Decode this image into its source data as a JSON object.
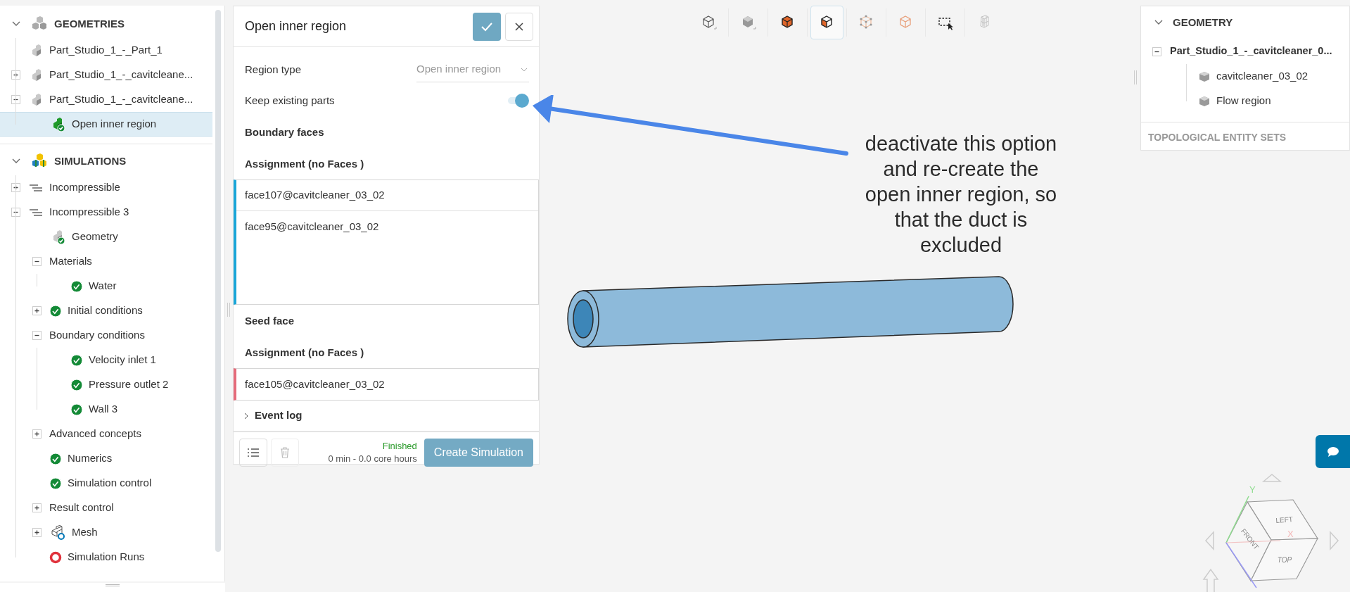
{
  "sidebar": {
    "sections": [
      {
        "title": "GEOMETRIES",
        "kind": "geometries",
        "expanded": true,
        "items": [
          {
            "label": "Part_Studio_1_-_Part_1",
            "kind": "part",
            "selected": false
          },
          {
            "label": "Part_Studio_1_-_cavitcleane...",
            "kind": "part",
            "expanded": false,
            "selected": false
          },
          {
            "label": "Part_Studio_1_-_cavitcleane...",
            "kind": "part",
            "expanded": true,
            "selected": false,
            "children": [
              {
                "label": "Open inner region",
                "kind": "region-check",
                "selected": true
              }
            ]
          }
        ]
      },
      {
        "title": "SIMULATIONS",
        "kind": "simulations",
        "expanded": true,
        "items": [
          {
            "label": "Incompressible",
            "kind": "lines",
            "expanded": false,
            "selected": false
          },
          {
            "label": "Incompressible 3",
            "kind": "lines",
            "expanded": true,
            "selected": false,
            "children": [
              {
                "label": "Geometry",
                "kind": "geometry-check",
                "selected": false
              },
              {
                "label": "Materials",
                "kind": "plain",
                "expanded": true,
                "selected": false,
                "children": [
                  {
                    "label": "Water",
                    "kind": "check",
                    "selected": false
                  }
                ]
              },
              {
                "label": "Initial conditions",
                "kind": "check",
                "expanded": false,
                "selected": false
              },
              {
                "label": "Boundary conditions",
                "kind": "plain",
                "expanded": true,
                "selected": false,
                "children": [
                  {
                    "label": "Velocity inlet 1",
                    "kind": "check",
                    "selected": false
                  },
                  {
                    "label": "Pressure outlet 2",
                    "kind": "check",
                    "selected": false
                  },
                  {
                    "label": "Wall 3",
                    "kind": "check",
                    "selected": false
                  }
                ]
              },
              {
                "label": "Advanced concepts",
                "kind": "plain",
                "expanded": false,
                "selected": false
              },
              {
                "label": "Numerics",
                "kind": "check",
                "selected": false
              },
              {
                "label": "Simulation control",
                "kind": "check",
                "selected": false
              },
              {
                "label": "Result control",
                "kind": "plain",
                "expanded": false,
                "selected": false
              },
              {
                "label": "Mesh",
                "kind": "mesh",
                "expanded": false,
                "selected": false
              },
              {
                "label": "Simulation Runs",
                "kind": "ring",
                "selected": false
              }
            ]
          }
        ]
      }
    ]
  },
  "dialog": {
    "title": "Open inner region",
    "region_type": {
      "label": "Region type",
      "value": "Open inner region"
    },
    "keep_existing_parts": {
      "label": "Keep existing parts",
      "on": true
    },
    "boundary_faces": {
      "heading": "Boundary faces",
      "assignment_label": "Assignment (no Faces )",
      "faces": [
        "face107@cavitcleaner_03_02",
        "face95@cavitcleaner_03_02"
      ]
    },
    "seed_face": {
      "heading": "Seed face",
      "assignment_label": "Assignment (no Faces )",
      "faces": [
        "face105@cavitcleaner_03_02"
      ]
    },
    "event_log": {
      "label": "Event log",
      "expanded": false
    },
    "status": "Finished",
    "cost": "0 min - 0.0 core hours",
    "create_button": "Create Simulation"
  },
  "toolbar": [
    {
      "kind": "wire",
      "selected": false
    },
    {
      "kind": "solid",
      "selected": false
    },
    {
      "kind": "solid-orange",
      "selected": false
    },
    {
      "kind": "half-orange",
      "selected": true
    },
    {
      "kind": "points",
      "selected": false
    },
    {
      "kind": "edges",
      "selected": false
    },
    {
      "kind": "box-select",
      "selected": false
    },
    {
      "kind": "mesh",
      "selected": false
    }
  ],
  "geometry_panel": {
    "title": "GEOMETRY",
    "root": {
      "label": "Part_Studio_1_-_cavitcleaner_0...",
      "expanded": true,
      "children": [
        "cavitcleaner_03_02",
        "Flow region"
      ]
    },
    "topological_entity_sets": "TOPOLOGICAL ENTITY SETS"
  },
  "annotation": {
    "lines": [
      "deactivate this option",
      "and re-create the",
      "open inner region, so",
      "that the duct is",
      "excluded"
    ]
  },
  "view_cube": {
    "faces": [
      "LEFT",
      "FRONT",
      "TOP"
    ],
    "axes": [
      "X",
      "Y"
    ]
  }
}
